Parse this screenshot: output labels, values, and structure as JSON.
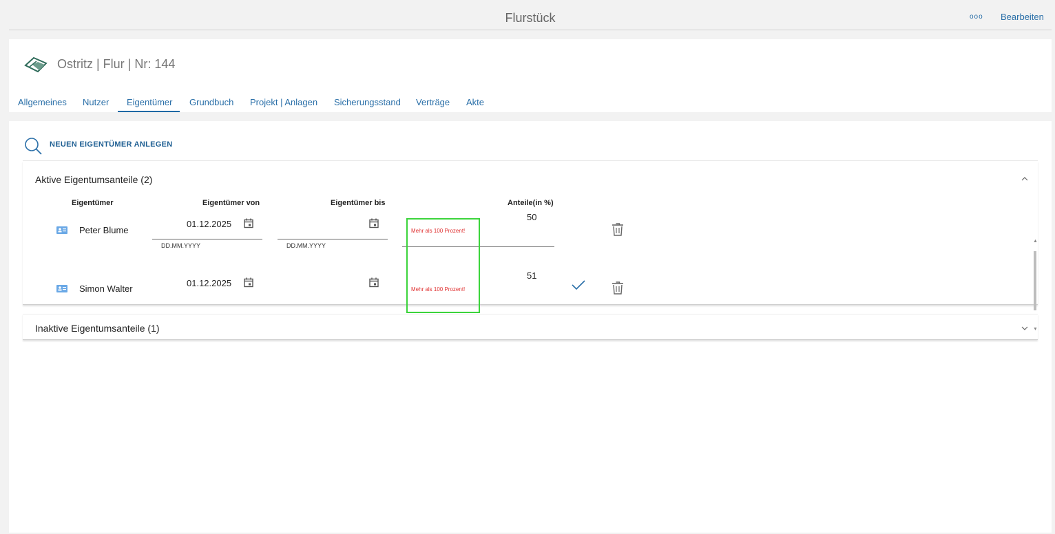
{
  "header": {
    "title": "Flurstück",
    "more_label": "ooo",
    "edit_label": "Bearbeiten"
  },
  "parcel": {
    "title": "Ostritz | Flur | Nr: 144"
  },
  "tabs": [
    {
      "label": "Allgemeines"
    },
    {
      "label": "Nutzer"
    },
    {
      "label": "Eigentümer"
    },
    {
      "label": "Grundbuch"
    },
    {
      "label": "Projekt | Anlagen"
    },
    {
      "label": "Sicherungsstand"
    },
    {
      "label": "Verträge"
    },
    {
      "label": "Akte"
    }
  ],
  "active_tab": "Eigentümer",
  "actions": {
    "new_owner_label": "NEUEN EIGENTÜMER ANLEGEN"
  },
  "active_panel": {
    "title": "Aktive Eigentumsanteile (2)",
    "columns": {
      "owner": "Eigentümer",
      "from": "Eigentümer von",
      "to": "Eigentümer bis",
      "share": "Anteile(in %)"
    },
    "rows": [
      {
        "name": "Peter Blume",
        "from": "01.12.2025",
        "from_hint": "DD.MM.YYYY",
        "to": "",
        "to_hint": "DD.MM.YYYY",
        "error": "Mehr als 100 Prozent!",
        "share": "50"
      },
      {
        "name": "Simon Walter",
        "from": "01.12.2025",
        "to": "",
        "error": "Mehr als 100 Prozent!",
        "share": "51"
      }
    ]
  },
  "inactive_panel": {
    "title": "Inaktive Eigentumsanteile (1)"
  },
  "colors": {
    "accent": "#2a6fa8",
    "error": "#e03131",
    "highlight": "#3bd43b"
  }
}
